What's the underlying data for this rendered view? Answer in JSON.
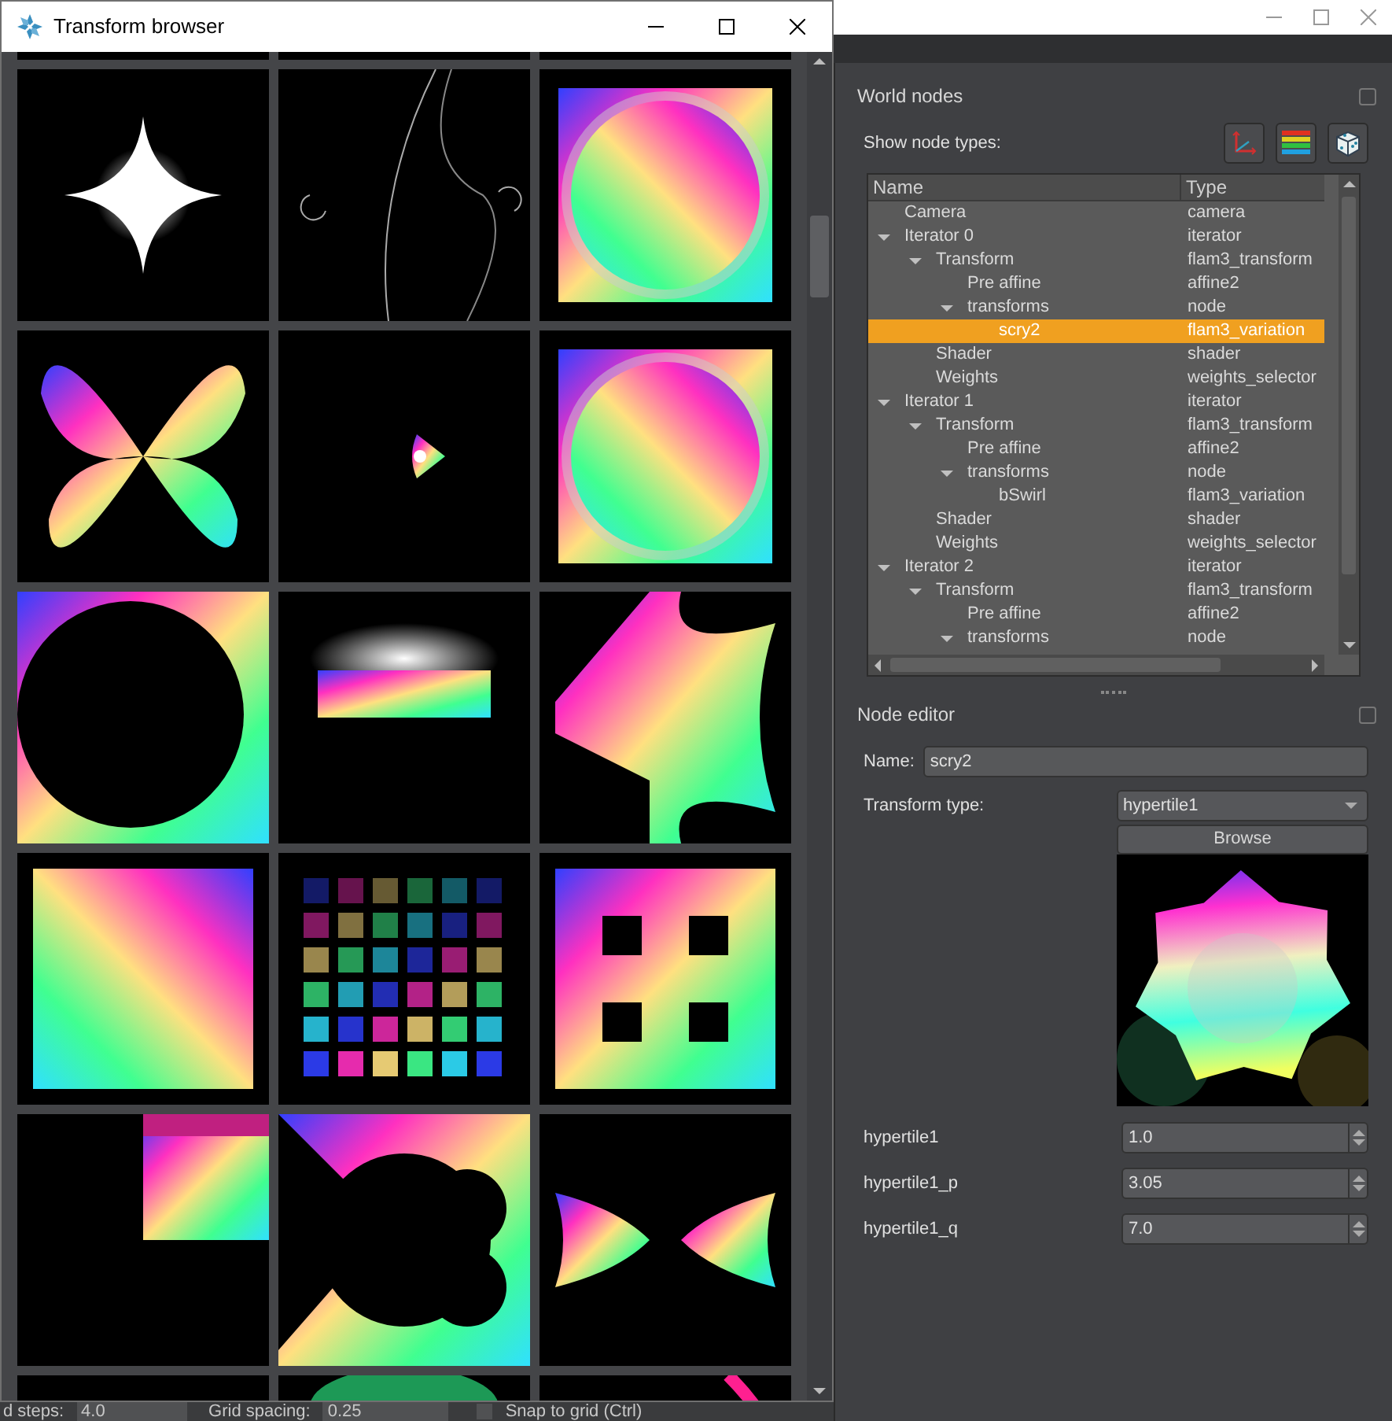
{
  "transform_browser": {
    "title": "Transform browser"
  },
  "bottom_strip": {
    "steps_label": "d steps:",
    "steps_value": "4.0",
    "grid_spacing_label": "Grid spacing:",
    "grid_spacing_value": "0.25",
    "snap_label": "Snap to grid (Ctrl)",
    "snap_checked": false
  },
  "world_nodes": {
    "title": "World nodes",
    "show_label": "Show node types:",
    "tree": {
      "columns": [
        "Name",
        "Type"
      ],
      "rows": [
        {
          "name": "Camera",
          "type": "camera",
          "selected": false
        },
        {
          "name": "Iterator 0",
          "type": "iterator",
          "expanded": true,
          "selected": false,
          "children": [
            {
              "name": "Transform",
              "type": "flam3_transform",
              "expanded": true,
              "selected": false,
              "children": [
                {
                  "name": "Pre affine",
                  "type": "affine2",
                  "selected": false
                },
                {
                  "name": "transforms",
                  "type": "node",
                  "expanded": true,
                  "selected": false,
                  "children": [
                    {
                      "name": "scry2",
                      "type": "flam3_variation",
                      "selected": true
                    }
                  ]
                }
              ]
            },
            {
              "name": "Shader",
              "type": "shader",
              "selected": false
            },
            {
              "name": "Weights",
              "type": "weights_selector",
              "selected": false
            }
          ]
        },
        {
          "name": "Iterator 1",
          "type": "iterator",
          "expanded": true,
          "selected": false,
          "children": [
            {
              "name": "Transform",
              "type": "flam3_transform",
              "expanded": true,
              "selected": false,
              "children": [
                {
                  "name": "Pre affine",
                  "type": "affine2",
                  "selected": false
                },
                {
                  "name": "transforms",
                  "type": "node",
                  "expanded": true,
                  "selected": false,
                  "children": [
                    {
                      "name": "bSwirl",
                      "type": "flam3_variation",
                      "selected": false
                    }
                  ]
                }
              ]
            },
            {
              "name": "Shader",
              "type": "shader",
              "selected": false
            },
            {
              "name": "Weights",
              "type": "weights_selector",
              "selected": false
            }
          ]
        },
        {
          "name": "Iterator 2",
          "type": "iterator",
          "expanded": true,
          "selected": false,
          "children": [
            {
              "name": "Transform",
              "type": "flam3_transform",
              "expanded": true,
              "selected": false,
              "children": [
                {
                  "name": "Pre affine",
                  "type": "affine2",
                  "selected": false
                },
                {
                  "name": "transforms",
                  "type": "node",
                  "expanded": true,
                  "selected": false
                }
              ]
            }
          ]
        }
      ]
    }
  },
  "node_editor": {
    "title": "Node editor",
    "name_label": "Name:",
    "name_value": "scry2",
    "transform_type_label": "Transform type:",
    "transform_type_value": "hypertile1",
    "browse_button": "Browse",
    "params": [
      {
        "label": "hypertile1",
        "value": "1.0"
      },
      {
        "label": "hypertile1_p",
        "value": "3.05"
      },
      {
        "label": "hypertile1_q",
        "value": "7.0"
      }
    ]
  }
}
